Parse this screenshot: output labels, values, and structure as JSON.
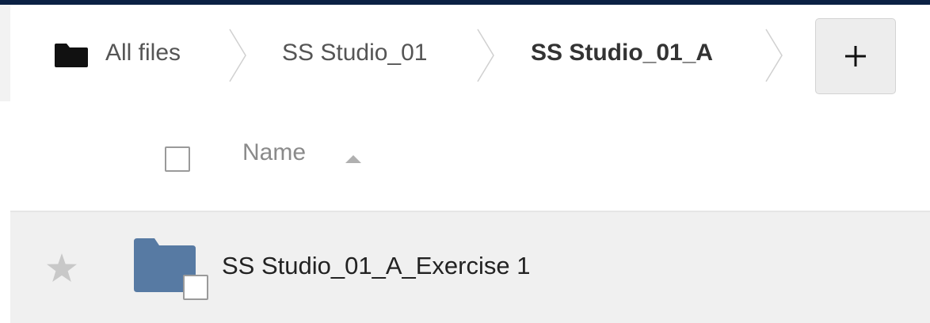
{
  "breadcrumb": {
    "items": [
      {
        "label": "All files"
      },
      {
        "label": "SS Studio_01"
      },
      {
        "label": "SS Studio_01_A"
      }
    ],
    "add_button_label": "+"
  },
  "file_list": {
    "header": {
      "name_label": "Name",
      "sort": "ascending"
    },
    "rows": [
      {
        "name": "SS Studio_01_A_Exercise 1",
        "type": "folder",
        "starred": false
      }
    ]
  },
  "colors": {
    "top_bar": "#0b2144",
    "folder": "#577aa3",
    "row_background": "#f0f0f0",
    "star": "#c8c8c8"
  },
  "icons": [
    "folder-icon",
    "chevron-separator-icon",
    "plus-icon",
    "sort-ascending-icon",
    "star-icon",
    "checkbox-icon"
  ]
}
